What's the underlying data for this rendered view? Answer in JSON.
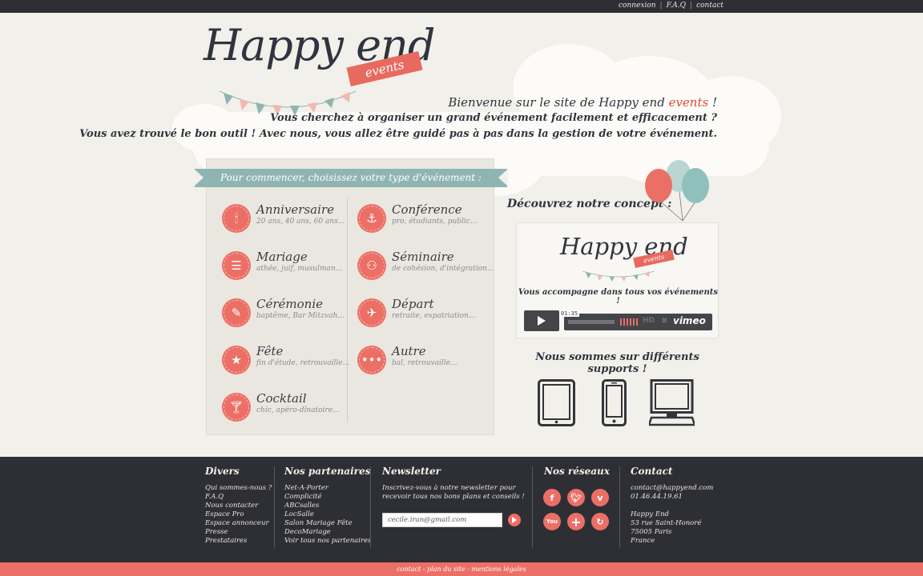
{
  "topbar": {
    "links": [
      "connexion",
      "F.A.Q",
      "contact"
    ],
    "separator": "|"
  },
  "logo": {
    "title": "Happy end",
    "ribbon": "events"
  },
  "welcome": {
    "line1_prefix": "Bienvenue sur le site de Happy end ",
    "line1_events": "events",
    "line1_suffix": " !",
    "line2": "Vous cherchez à organiser un grand événement facilement et efficacement ?",
    "line3": "Vous avez trouvé le bon outil ! Avec nous, vous allez être guidé pas à pas dans la gestion de votre événement."
  },
  "events_panel": {
    "heading": "Pour commencer, choisissez votre type d'événement :",
    "items": [
      {
        "title": "Anniversaire",
        "subtitle": "20 ans, 40 ans, 60 ans...",
        "icon": "candle-icon"
      },
      {
        "title": "Conférence",
        "subtitle": "pro, étudiants, public...",
        "icon": "microphone-icon"
      },
      {
        "title": "Mariage",
        "subtitle": "athée, juif, musulman...",
        "icon": "wedding-cake-icon"
      },
      {
        "title": "Séminaire",
        "subtitle": "de cohésion, d'intégration...",
        "icon": "group-icon"
      },
      {
        "title": "Cérémonie",
        "subtitle": "baptême, Bar Mitzvah...",
        "icon": "pencil-icon"
      },
      {
        "title": "Départ",
        "subtitle": "retraite, expatriation...",
        "icon": "departure-icon"
      },
      {
        "title": "Fête",
        "subtitle": "fin d'étude, retrouvaille...",
        "icon": "party-icon"
      },
      {
        "title": "Autre",
        "subtitle": "bal, retrouvaille...",
        "icon": "more-icon"
      },
      {
        "title": "Cocktail",
        "subtitle": "chic, apéro-dînatoire...",
        "icon": "cocktail-icon"
      }
    ]
  },
  "concept": {
    "heading": "Découvrez notre concept :",
    "video": {
      "logo": "Happy end",
      "ribbon": "events",
      "tagline": "Vous accompagne dans tous vos événements !",
      "time": "01:35",
      "hd_label": "HD",
      "brand": "vimeo"
    }
  },
  "supports": {
    "heading": "Nous sommes sur différents supports !",
    "devices": [
      "tablet-icon",
      "phone-icon",
      "desktop-icon"
    ]
  },
  "footer": {
    "divers": {
      "heading": "Divers",
      "items": [
        "Qui sommes-nous ?",
        "F.A.Q",
        "Nous contacter",
        "Espace Pro",
        "Espace annonceur",
        "Presse",
        "Prestataires"
      ]
    },
    "partners": {
      "heading": "Nos partenaires",
      "items": [
        "Net-A-Porter",
        "Complicité",
        "ABCsalles",
        "LocSalle",
        "Salon Mariage Fête",
        "DecoMariage",
        "Voir tous nos partenaires"
      ]
    },
    "newsletter": {
      "heading": "Newsletter",
      "text": "Inscrivez-vous à notre newsletter pour recevoir tous nos bons plans et conseils !",
      "input_value": "cecile.iran@gmail.com"
    },
    "social": {
      "heading": "Nos réseaux",
      "icons": [
        "facebook-icon",
        "twitter-icon",
        "vimeo-icon",
        "youtube-icon",
        "plus-icon",
        "share-icon"
      ]
    },
    "contact": {
      "heading": "Contact",
      "email": "contact@happyend.com",
      "phone": "01.46.44.19.61",
      "name": "Happy End",
      "street": "53 rue Saint-Honoré",
      "city": "75005 Paris",
      "country": "France"
    }
  },
  "bottombar": {
    "text": "contact - plan du site - mentions légales"
  },
  "colors": {
    "accent": "#ec6f66",
    "dark": "#2e2f34",
    "teal": "#8fb5b2",
    "background": "#f2f0ea"
  }
}
